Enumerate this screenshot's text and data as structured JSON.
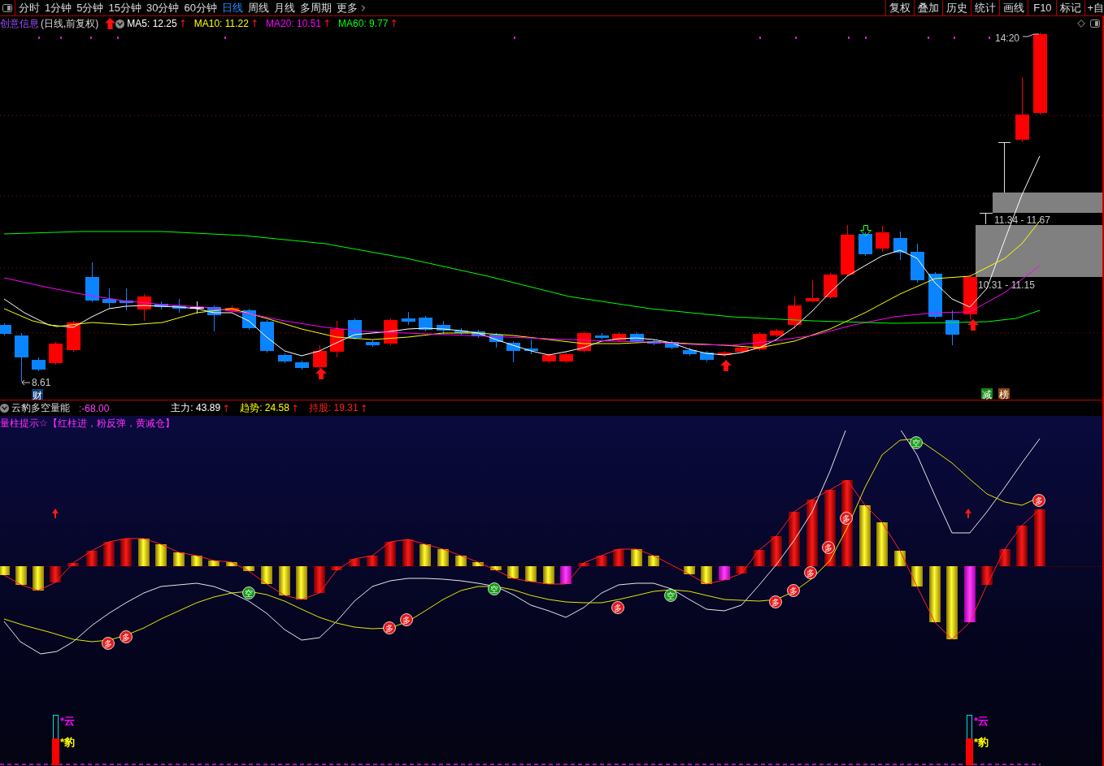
{
  "toolbar": {
    "periods": [
      {
        "label": "分时",
        "selected": false
      },
      {
        "label": "1分钟",
        "selected": false
      },
      {
        "label": "5分钟",
        "selected": false
      },
      {
        "label": "15分钟",
        "selected": false
      },
      {
        "label": "30分钟",
        "selected": false
      },
      {
        "label": "60分钟",
        "selected": false
      },
      {
        "label": "日线",
        "selected": true
      },
      {
        "label": "周线",
        "selected": false
      },
      {
        "label": "月线",
        "selected": false
      },
      {
        "label": "多周期",
        "selected": false
      },
      {
        "label": "更多",
        "selected": false
      }
    ],
    "actions": [
      "复权",
      "叠加",
      "历史",
      "统计",
      "画线",
      "F10",
      "标记",
      "+自"
    ]
  },
  "price_chart": {
    "stock_name": "创意信息",
    "mode": "(日线,前复权)",
    "moving_averages": [
      {
        "label": "MA5: 12.25",
        "color": "#ffffff",
        "arrow": "↑"
      },
      {
        "label": "MA10: 11.22",
        "color": "#ffff00",
        "arrow": "↑"
      },
      {
        "label": "MA20: 10.51",
        "color": "#ff00ff",
        "arrow": "↑"
      },
      {
        "label": "MA60: 9.77",
        "color": "#00ff00",
        "arrow": "↑"
      }
    ],
    "high_label": "14:20",
    "low_label": "8.61",
    "zones": [
      {
        "label": "11.34 - 11.67"
      },
      {
        "label": "10.31 - 11.15"
      }
    ],
    "tags": [
      {
        "label": "财",
        "color": "#0c3c78"
      },
      {
        "label": "减",
        "color": "#148a14"
      },
      {
        "label": "榜",
        "color": "#8a4810"
      }
    ]
  },
  "indicator": {
    "name": "云豹多空量能",
    "reading": ":-68.00",
    "values": [
      {
        "label": "主力: 43.89",
        "color": "#ffffff",
        "arrow": "↑"
      },
      {
        "label": "趋势: 24.58",
        "color": "#ffff00",
        "arrow": "↑"
      },
      {
        "label": "持股: 19.31",
        "color": "#ff2020",
        "arrow": "↑"
      }
    ],
    "hint": "量柱提示☆【红柱进，粉反弹，黄减仓】",
    "signals": [
      {
        "kind": "long",
        "label": "多"
      },
      {
        "kind": "long",
        "label": "多"
      },
      {
        "kind": "short",
        "label": "空"
      },
      {
        "kind": "long",
        "label": "多"
      },
      {
        "kind": "long",
        "label": "多"
      },
      {
        "kind": "short",
        "label": "空"
      },
      {
        "kind": "long",
        "label": "多"
      },
      {
        "kind": "short",
        "label": "空"
      },
      {
        "kind": "long",
        "label": "多"
      },
      {
        "kind": "long",
        "label": "多"
      },
      {
        "kind": "long",
        "label": "多"
      },
      {
        "kind": "long",
        "label": "多"
      },
      {
        "kind": "long",
        "label": "多"
      },
      {
        "kind": "short",
        "label": "空"
      },
      {
        "kind": "long",
        "label": "多"
      }
    ],
    "gauges": [
      {
        "level": 0.53,
        "labels": [
          {
            "label": "*云",
            "color": "#ff00ff"
          },
          {
            "label": "*豹",
            "color": "#ffff00"
          }
        ]
      },
      {
        "level": 0.53,
        "labels": [
          {
            "label": "*云",
            "color": "#ff00ff"
          },
          {
            "label": "*豹",
            "color": "#ffff00"
          }
        ]
      }
    ]
  }
}
